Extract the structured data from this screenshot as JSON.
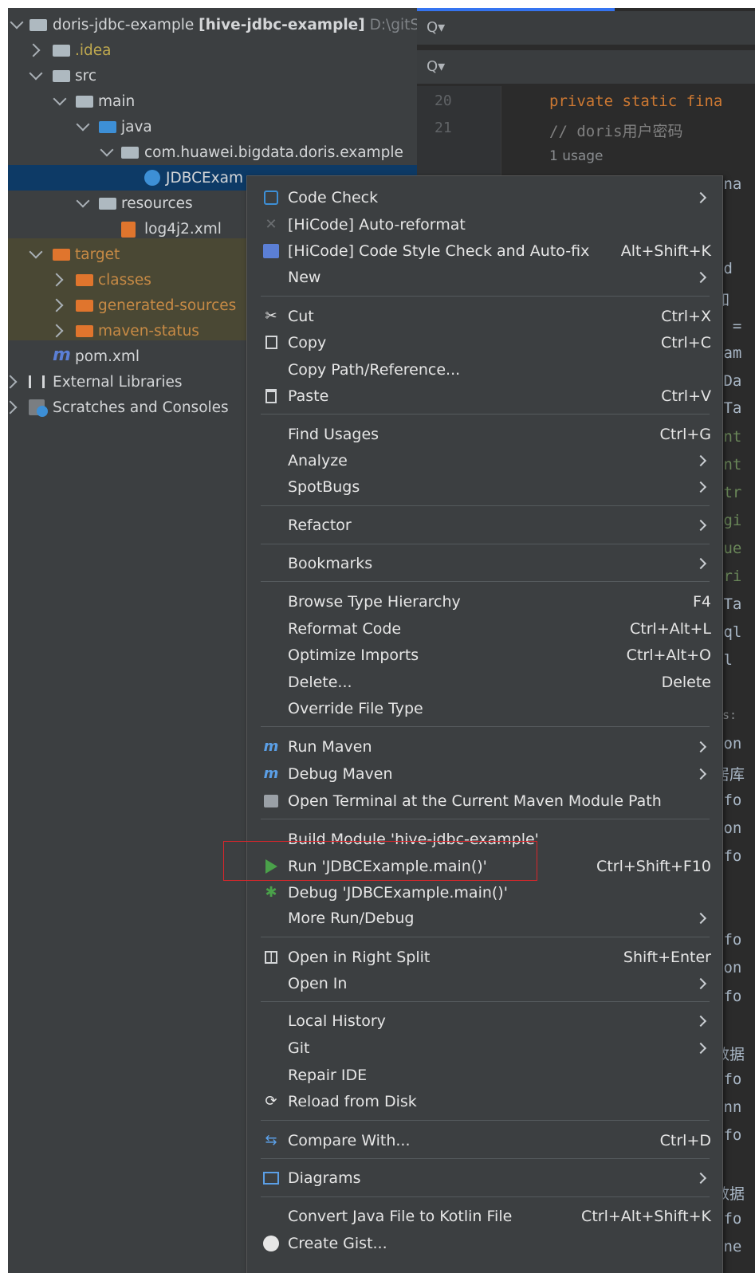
{
  "project_tree": {
    "root": {
      "name": "doris-jdbc-example",
      "module": "[hive-jdbc-example]",
      "path": "D:\\gitS"
    },
    "items": [
      {
        "label": ".idea"
      },
      {
        "label": "src"
      },
      {
        "label": "main"
      },
      {
        "label": "java"
      },
      {
        "label": "com.huawei.bigdata.doris.example"
      },
      {
        "label": "JDBCExam"
      },
      {
        "label": "resources"
      },
      {
        "label": "log4j2.xml"
      },
      {
        "label": "target"
      },
      {
        "label": "classes"
      },
      {
        "label": "generated-sources"
      },
      {
        "label": "maven-status"
      },
      {
        "label": "pom.xml"
      },
      {
        "label": "External Libraries"
      },
      {
        "label": "Scratches and Consoles"
      }
    ]
  },
  "editor": {
    "search_icon": "Q▾",
    "line_numbers": [
      "20",
      "21"
    ],
    "line20_keywords": "private static fina",
    "line21_comment": "// doris用户密码",
    "usage": "1 usage",
    "fragments": [
      "ina",
      "id",
      "加",
      "e =",
      "Nam",
      "eDa",
      "eTa",
      "int",
      "int",
      "str",
      "ngi",
      "que",
      "tri",
      "tTa",
      "Sql",
      "ql",
      "s:",
      "ion",
      "居库",
      "nfo",
      "con",
      "nfo",
      "nfo",
      "con",
      "nfo",
      "数据",
      "nfo",
      "onn",
      "nfo",
      "数据",
      "nfo",
      "nne"
    ]
  },
  "context_menu": {
    "items": [
      {
        "label": "Code Check",
        "shortcut": "",
        "submenu": true,
        "icon": "code-check-icon"
      },
      {
        "label": "[HiCode] Auto-reformat",
        "shortcut": "",
        "submenu": false,
        "icon": "hicode-reformat-icon"
      },
      {
        "label": "[HiCode] Code Style Check and Auto-fix",
        "shortcut": "Alt+Shift+K",
        "submenu": false,
        "icon": "hicode-style-icon"
      },
      {
        "label": "New",
        "shortcut": "",
        "submenu": true,
        "icon": ""
      },
      {
        "label": "Cut",
        "shortcut": "Ctrl+X",
        "submenu": false,
        "icon": "scissors-icon"
      },
      {
        "label": "Copy",
        "shortcut": "Ctrl+C",
        "submenu": false,
        "icon": "copy-icon"
      },
      {
        "label": "Copy Path/Reference...",
        "shortcut": "",
        "submenu": false,
        "icon": ""
      },
      {
        "label": "Paste",
        "shortcut": "Ctrl+V",
        "submenu": false,
        "icon": "clipboard-icon"
      },
      {
        "label": "Find Usages",
        "shortcut": "Ctrl+G",
        "submenu": false,
        "icon": ""
      },
      {
        "label": "Analyze",
        "shortcut": "",
        "submenu": true,
        "icon": ""
      },
      {
        "label": "SpotBugs",
        "shortcut": "",
        "submenu": true,
        "icon": ""
      },
      {
        "label": "Refactor",
        "shortcut": "",
        "submenu": true,
        "icon": ""
      },
      {
        "label": "Bookmarks",
        "shortcut": "",
        "submenu": true,
        "icon": ""
      },
      {
        "label": "Browse Type Hierarchy",
        "shortcut": "F4",
        "submenu": false,
        "icon": ""
      },
      {
        "label": "Reformat Code",
        "shortcut": "Ctrl+Alt+L",
        "submenu": false,
        "icon": ""
      },
      {
        "label": "Optimize Imports",
        "shortcut": "Ctrl+Alt+O",
        "submenu": false,
        "icon": ""
      },
      {
        "label": "Delete...",
        "shortcut": "Delete",
        "submenu": false,
        "icon": ""
      },
      {
        "label": "Override File Type",
        "shortcut": "",
        "submenu": false,
        "icon": ""
      },
      {
        "label": "Run Maven",
        "shortcut": "",
        "submenu": true,
        "icon": "maven-run-icon"
      },
      {
        "label": "Debug Maven",
        "shortcut": "",
        "submenu": true,
        "icon": "maven-debug-icon"
      },
      {
        "label": "Open Terminal at the Current Maven Module Path",
        "shortcut": "",
        "submenu": false,
        "icon": "maven-terminal-icon"
      },
      {
        "label": "Build Module 'hive-jdbc-example'",
        "shortcut": "",
        "submenu": false,
        "icon": ""
      },
      {
        "label": "Run 'JDBCExample.main()'",
        "shortcut": "Ctrl+Shift+F10",
        "submenu": false,
        "icon": "run-icon"
      },
      {
        "label": "Debug 'JDBCExample.main()'",
        "shortcut": "",
        "submenu": false,
        "icon": "debug-icon"
      },
      {
        "label": "More Run/Debug",
        "shortcut": "",
        "submenu": true,
        "icon": ""
      },
      {
        "label": "Open in Right Split",
        "shortcut": "Shift+Enter",
        "submenu": false,
        "icon": "split-icon"
      },
      {
        "label": "Open In",
        "shortcut": "",
        "submenu": true,
        "icon": ""
      },
      {
        "label": "Local History",
        "shortcut": "",
        "submenu": true,
        "icon": ""
      },
      {
        "label": "Git",
        "shortcut": "",
        "submenu": true,
        "icon": ""
      },
      {
        "label": "Repair IDE",
        "shortcut": "",
        "submenu": false,
        "icon": ""
      },
      {
        "label": "Reload from Disk",
        "shortcut": "",
        "submenu": false,
        "icon": "reload-icon"
      },
      {
        "label": "Compare With...",
        "shortcut": "Ctrl+D",
        "submenu": false,
        "icon": "compare-icon"
      },
      {
        "label": "Diagrams",
        "shortcut": "",
        "submenu": true,
        "icon": "diagram-icon"
      },
      {
        "label": "Convert Java File to Kotlin File",
        "shortcut": "Ctrl+Alt+Shift+K",
        "submenu": false,
        "icon": ""
      },
      {
        "label": "Create Gist...",
        "shortcut": "",
        "submenu": false,
        "icon": "github-icon"
      }
    ]
  },
  "colors": {
    "highlight_border": "#d9262b",
    "selection": "#0d3a66",
    "run_green": "#4aa14a"
  }
}
